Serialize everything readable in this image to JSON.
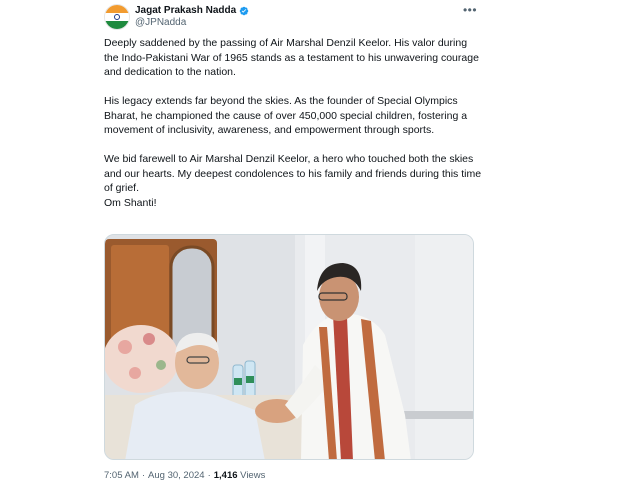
{
  "author": {
    "display_name": "Jagat Prakash Nadda",
    "handle": "@JPNadda",
    "verified": true,
    "avatar_icon": "india-flag-avatar"
  },
  "tweet": {
    "paragraphs": [
      "Deeply saddened by the passing of Air Marshal Denzil Keelor. His valor during the Indo-Pakistani War of 1965 stands as a testament to his unwavering courage and dedication to the nation.",
      "His legacy extends far beyond the skies. As the founder of Special Olympics Bharat, he championed the cause of over 450,000 special children, fostering a movement of inclusivity, awareness, and empowerment through sports.",
      "We bid farewell to Air Marshal Denzil Keelor, a hero who touched both the skies and our hearts. My deepest condolences to his family and friends during this time of grief.\nOm Shanti!"
    ]
  },
  "meta": {
    "time": "7:05 AM",
    "date": "Aug 30, 2024",
    "views_count": "1,416",
    "views_label": "Views",
    "separator": "·"
  },
  "icons": {
    "more": "more-options-icon",
    "verified": "verified-badge-icon"
  },
  "colors": {
    "text": "#0f1419",
    "secondary": "#536471",
    "verified": "#1d9bf0",
    "border": "#cfd9de"
  }
}
